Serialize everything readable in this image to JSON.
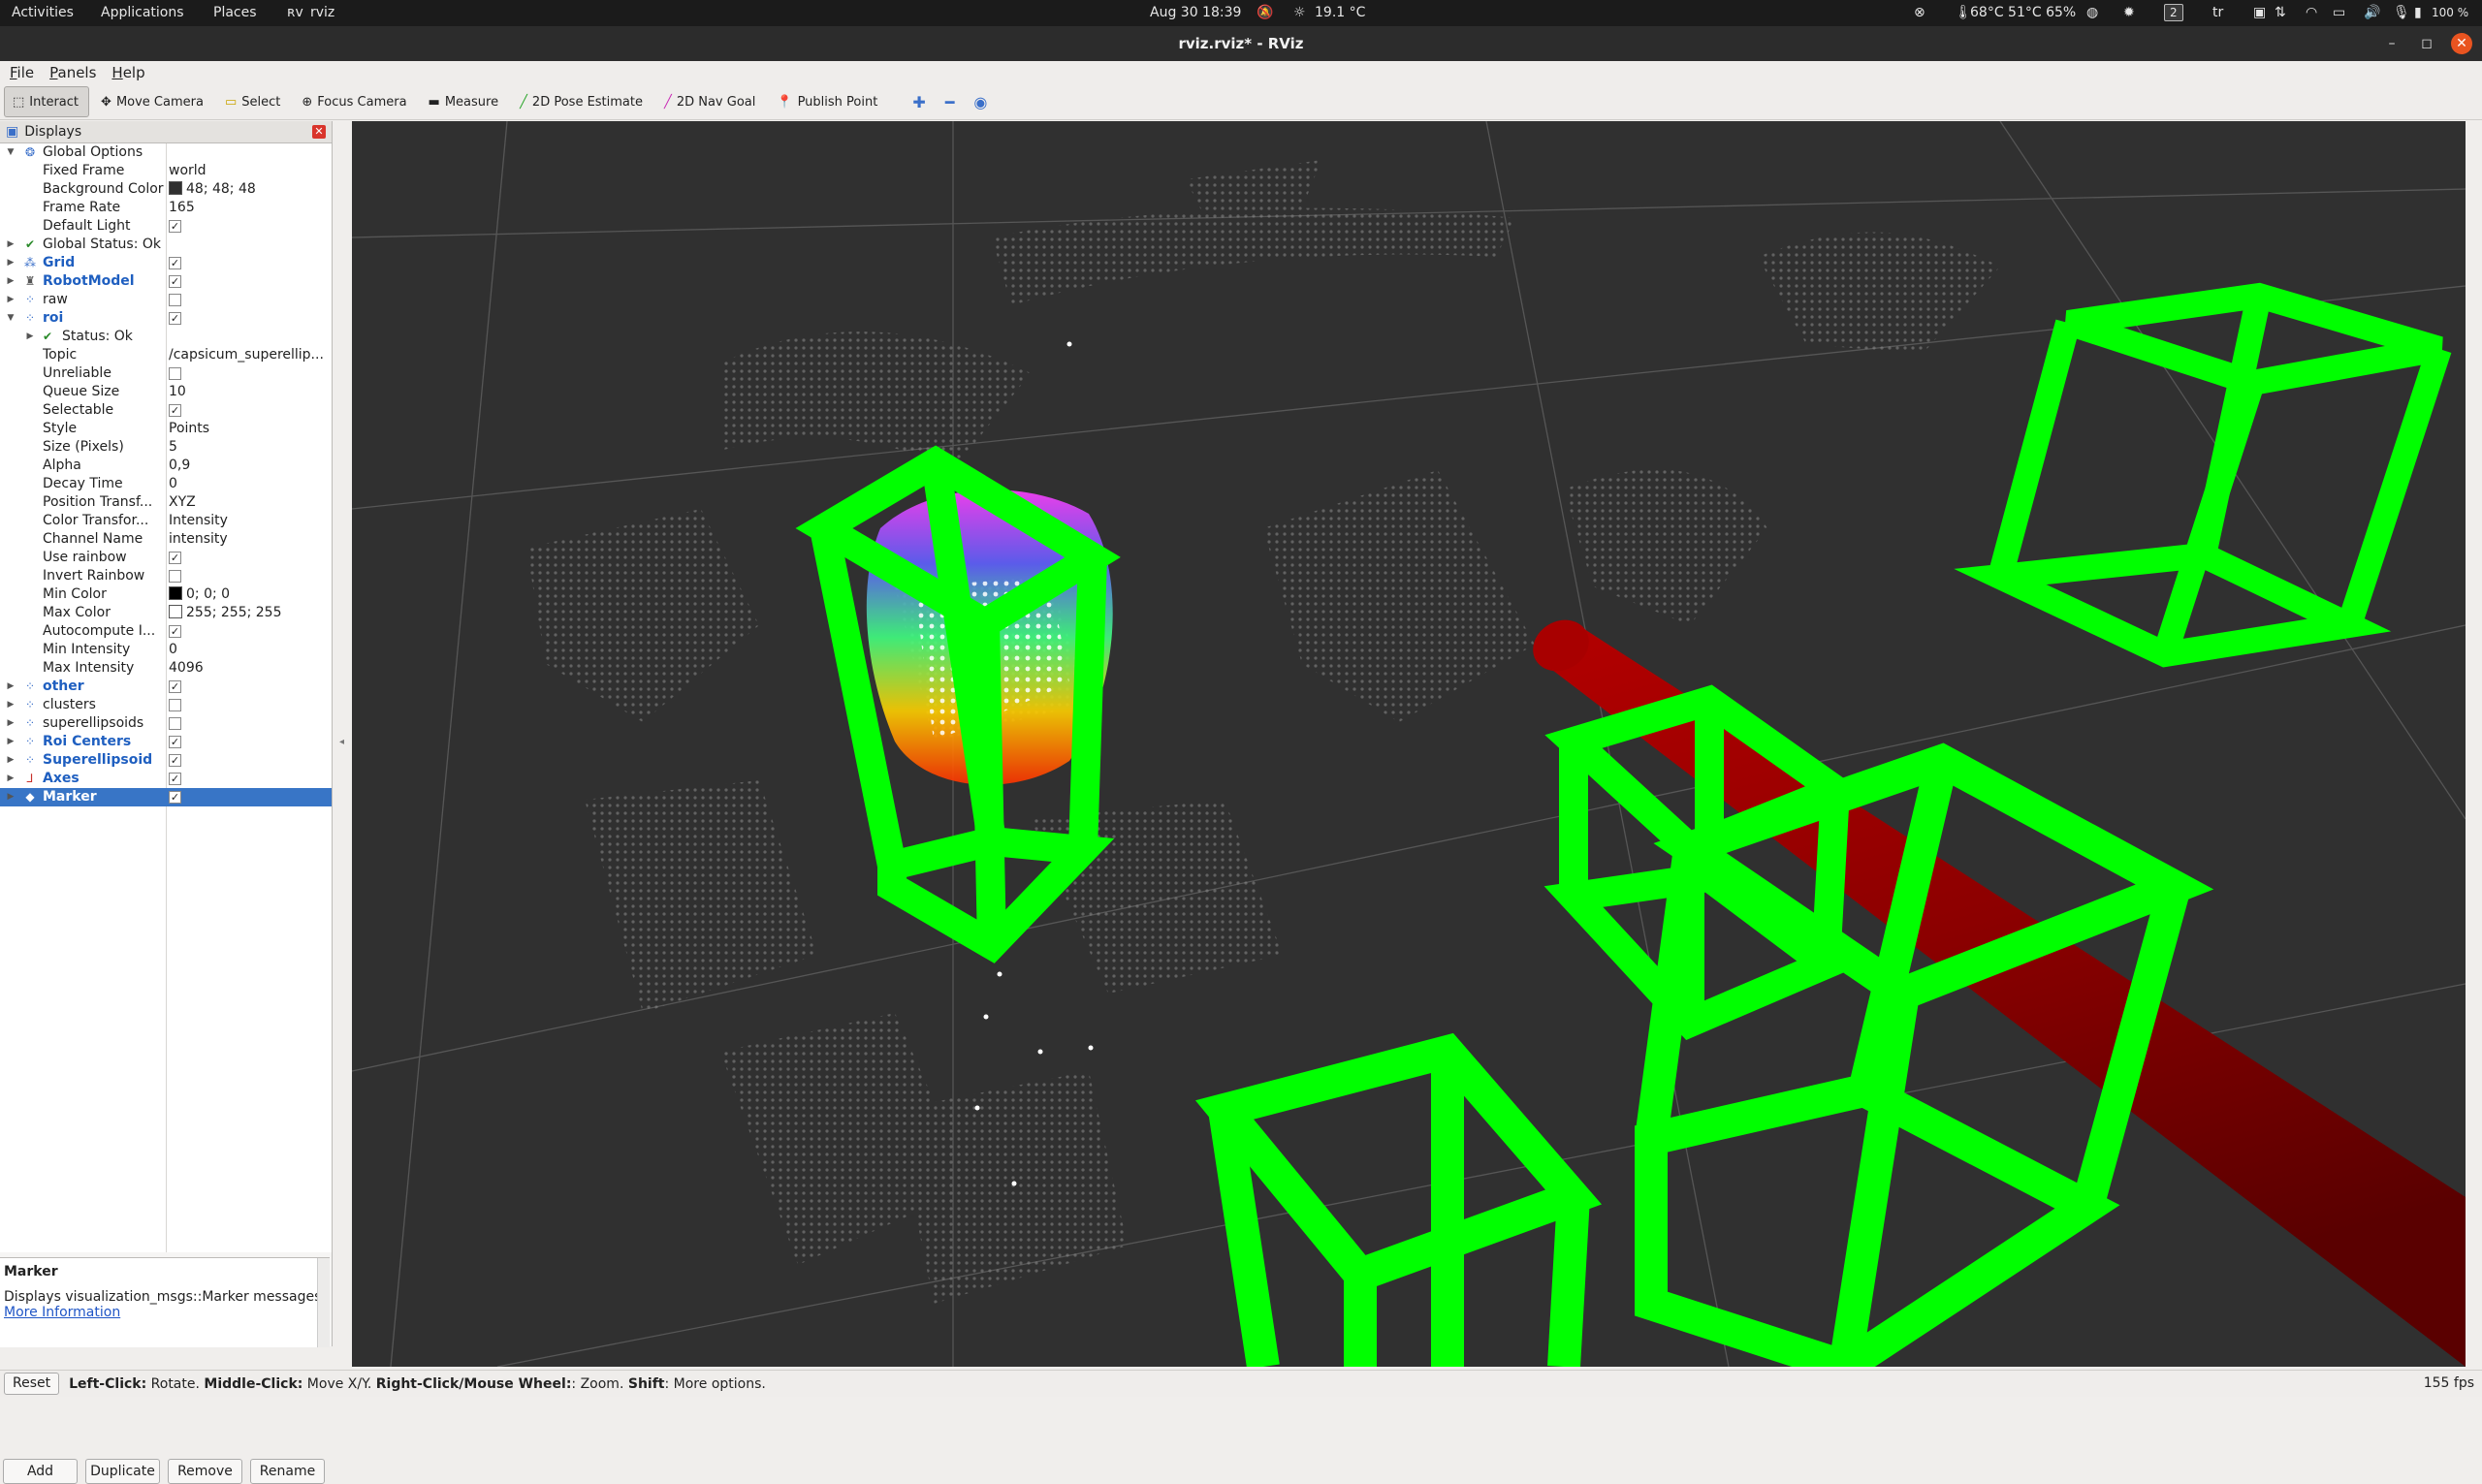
{
  "topbar": {
    "activities": "Activities",
    "applications": "Applications",
    "places": "Places",
    "rviz_label": "rviz",
    "datetime": "Aug 30  18:39",
    "weather": "19.1 °C",
    "sensors": "68°C 51°C 65%",
    "workspace": "2",
    "keyboard": "tr",
    "battery": "100 %"
  },
  "window": {
    "title": "rviz.rviz* - RViz"
  },
  "menu": [
    "File",
    "Panels",
    "Help"
  ],
  "toolbar": {
    "tools": [
      {
        "label": "Interact",
        "icon": "interact-icon",
        "active": true
      },
      {
        "label": "Move Camera",
        "icon": "move-camera-icon"
      },
      {
        "label": "Select",
        "icon": "select-icon"
      },
      {
        "label": "Focus Camera",
        "icon": "focus-camera-icon"
      },
      {
        "label": "Measure",
        "icon": "measure-icon"
      },
      {
        "label": "2D Pose Estimate",
        "icon": "pose-estimate-icon"
      },
      {
        "label": "2D Nav Goal",
        "icon": "nav-goal-icon"
      },
      {
        "label": "Publish Point",
        "icon": "publish-point-icon"
      }
    ]
  },
  "panel": {
    "title": "Displays",
    "rows": [
      {
        "indent": 0,
        "arrow": "down",
        "icon": "gear-icon",
        "name": "Global Options",
        "value": ""
      },
      {
        "indent": 1,
        "name": "Fixed Frame",
        "value": "world"
      },
      {
        "indent": 1,
        "name": "Background Color",
        "value": "48; 48; 48",
        "swatch": "#303030"
      },
      {
        "indent": 1,
        "name": "Frame Rate",
        "value": "165"
      },
      {
        "indent": 1,
        "name": "Default Light",
        "check": true
      },
      {
        "indent": 0,
        "arrow": "right",
        "icon": "checkmark-icon",
        "name": "Global Status: Ok",
        "value": ""
      },
      {
        "indent": 0,
        "arrow": "right",
        "icon": "grid-icon",
        "name": "Grid",
        "blue": true,
        "check": true
      },
      {
        "indent": 0,
        "arrow": "right",
        "icon": "robot-model-icon",
        "name": "RobotModel",
        "blue": true,
        "check": true
      },
      {
        "indent": 0,
        "arrow": "right",
        "icon": "pointcloud-icon",
        "name": "raw",
        "check": false
      },
      {
        "indent": 0,
        "arrow": "down",
        "icon": "pointcloud-icon",
        "name": "roi",
        "blue": true,
        "check": true
      },
      {
        "indent": 1,
        "arrow": "right",
        "icon": "checkmark-icon",
        "name": "Status: Ok",
        "value": ""
      },
      {
        "indent": 1,
        "name": "Topic",
        "value": "/capsicum_superellip..."
      },
      {
        "indent": 1,
        "name": "Unreliable",
        "check": false
      },
      {
        "indent": 1,
        "name": "Queue Size",
        "value": "10"
      },
      {
        "indent": 1,
        "name": "Selectable",
        "check": true
      },
      {
        "indent": 1,
        "name": "Style",
        "value": "Points"
      },
      {
        "indent": 1,
        "name": "Size (Pixels)",
        "value": "5"
      },
      {
        "indent": 1,
        "name": "Alpha",
        "value": "0,9"
      },
      {
        "indent": 1,
        "name": "Decay Time",
        "value": "0"
      },
      {
        "indent": 1,
        "name": "Position Transf...",
        "value": "XYZ"
      },
      {
        "indent": 1,
        "name": "Color Transfor...",
        "value": "Intensity"
      },
      {
        "indent": 1,
        "name": "Channel Name",
        "value": "intensity"
      },
      {
        "indent": 1,
        "name": "Use rainbow",
        "check": true
      },
      {
        "indent": 1,
        "name": "Invert Rainbow",
        "check": false
      },
      {
        "indent": 1,
        "name": "Min Color",
        "value": "0; 0; 0",
        "swatch": "#000000"
      },
      {
        "indent": 1,
        "name": "Max Color",
        "value": "255; 255; 255",
        "swatch": "#ffffff"
      },
      {
        "indent": 1,
        "name": "Autocompute I...",
        "check": true
      },
      {
        "indent": 1,
        "name": "Min Intensity",
        "value": "0"
      },
      {
        "indent": 1,
        "name": "Max Intensity",
        "value": "4096"
      },
      {
        "indent": 0,
        "arrow": "right",
        "icon": "pointcloud-icon",
        "name": "other",
        "blue": true,
        "check": true
      },
      {
        "indent": 0,
        "arrow": "right",
        "icon": "pointcloud-icon",
        "name": "clusters",
        "check": false
      },
      {
        "indent": 0,
        "arrow": "right",
        "icon": "pointcloud-icon",
        "name": "superellipsoids",
        "check": false
      },
      {
        "indent": 0,
        "arrow": "right",
        "icon": "pointcloud-icon",
        "name": "Roi Centers",
        "blue": true,
        "check": true
      },
      {
        "indent": 0,
        "arrow": "right",
        "icon": "pointcloud-icon",
        "name": "Superellipsoid",
        "blue": true,
        "check": true
      },
      {
        "indent": 0,
        "arrow": "right",
        "icon": "axes-icon",
        "name": "Axes",
        "blue": true,
        "check": true
      },
      {
        "indent": 0,
        "arrow": "right",
        "icon": "marker-icon",
        "name": "Marker",
        "blue": true,
        "check": true,
        "selected": true
      }
    ],
    "description": {
      "title": "Marker",
      "text": "Displays visualization_msgs::Marker messages.",
      "link": "More Information"
    },
    "buttons": [
      "Add",
      "Duplicate",
      "Remove",
      "Rename"
    ]
  },
  "status": {
    "reset": "Reset",
    "left_click": "Left-Click:",
    "left_click_desc": " Rotate. ",
    "middle_click": "Middle-Click:",
    "middle_click_desc": " Move X/Y. ",
    "right_click": "Right-Click/Mouse Wheel:",
    "right_click_desc": ": Zoom. ",
    "shift": "Shift",
    "shift_desc": ": More options.",
    "fps": "155 fps"
  },
  "colors": {
    "background": "#303030",
    "marker_green": "#00ff00",
    "cylinder_red": "#9a0000",
    "selection": "#3875c6"
  }
}
